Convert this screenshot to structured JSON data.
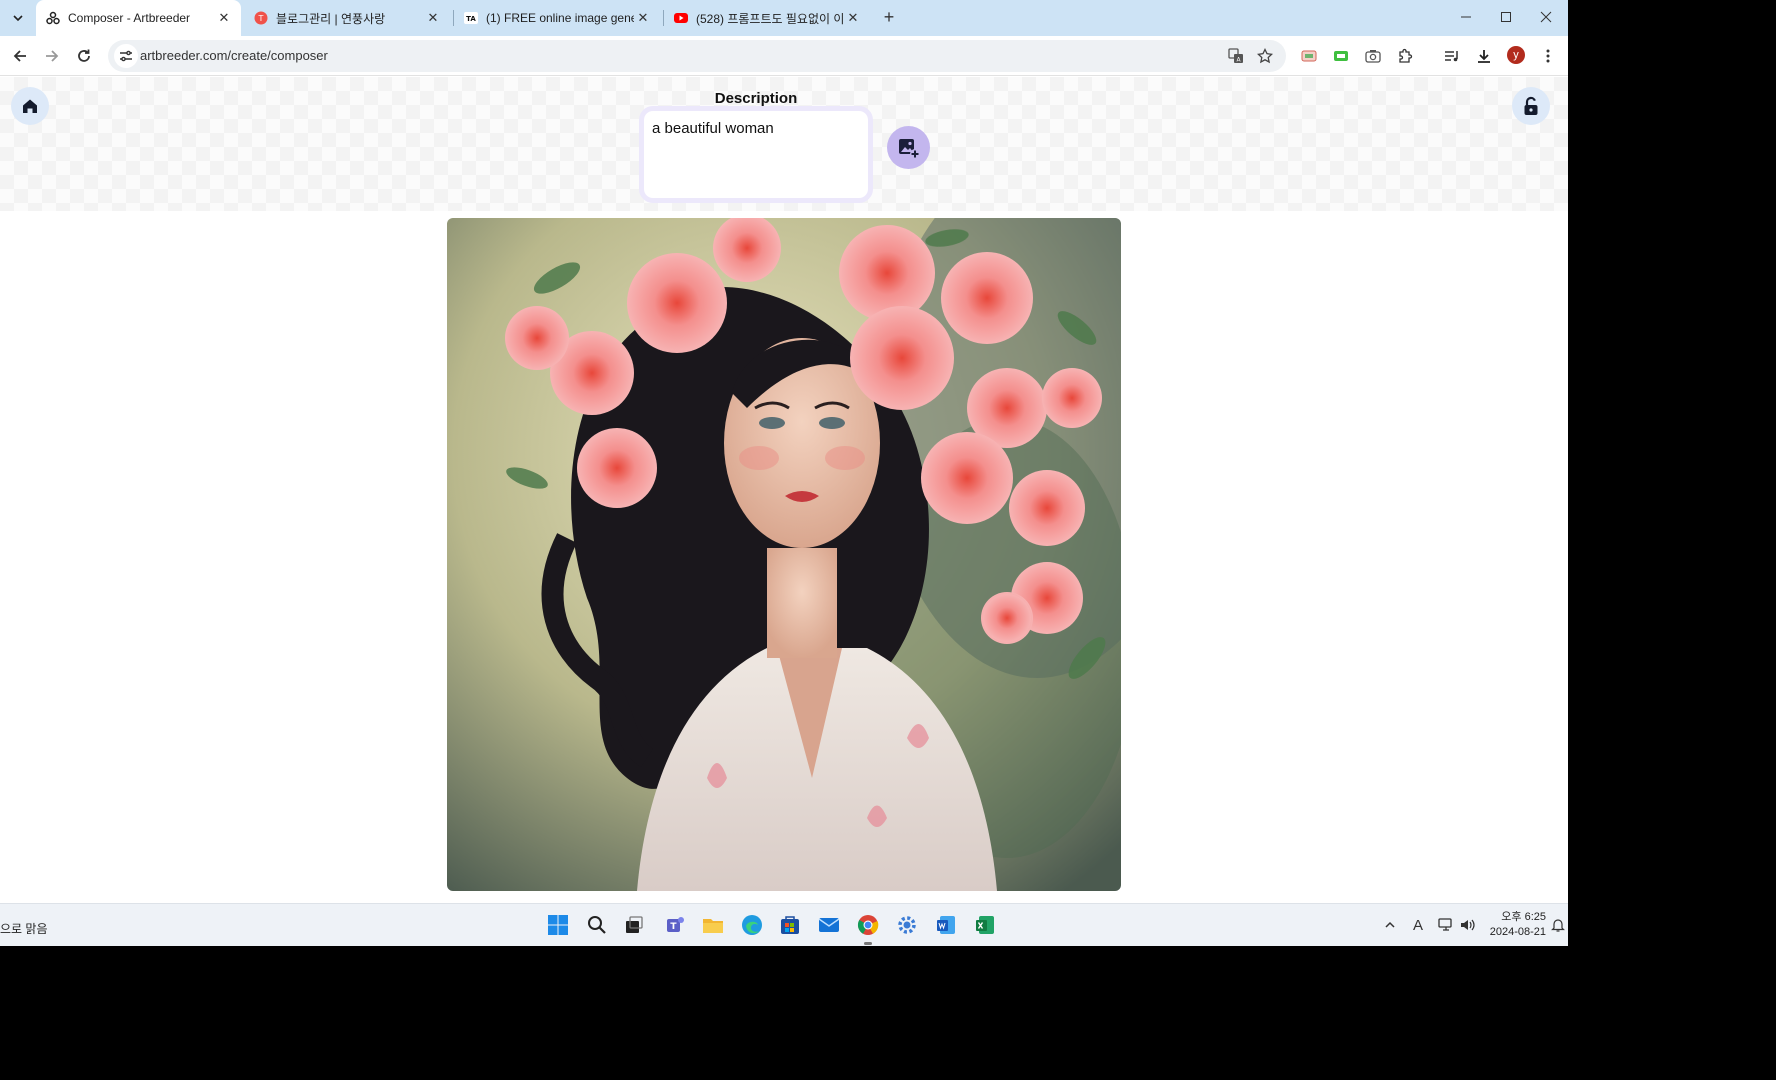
{
  "browser": {
    "tabs": [
      {
        "title": "Composer - Artbreeder",
        "active": true,
        "icon": "artbreeder-icon"
      },
      {
        "title": "블로그관리 | 연풍사랑",
        "active": false,
        "icon": "tistory-icon"
      },
      {
        "title": "(1) FREE online image generat",
        "active": false,
        "icon": "ta-icon"
      },
      {
        "title": "(528) 프롬프트도 필요없이 이미",
        "active": false,
        "icon": "youtube-icon"
      }
    ],
    "tab_close_glyph": "✕",
    "new_tab_glyph": "+",
    "url": "artbreeder.com/create/composer",
    "avatar_letter": "y"
  },
  "composer": {
    "description_label": "Description",
    "description_value": "a beautiful woman"
  },
  "taskbar": {
    "weather": "으로 맑음",
    "time": "오후 6:25",
    "date": "2024-08-21",
    "ime": "A"
  },
  "colors": {
    "tabstrip": "#cde3f5",
    "accent_lavender": "#c3b6ee",
    "round_button": "#dde9f8"
  }
}
